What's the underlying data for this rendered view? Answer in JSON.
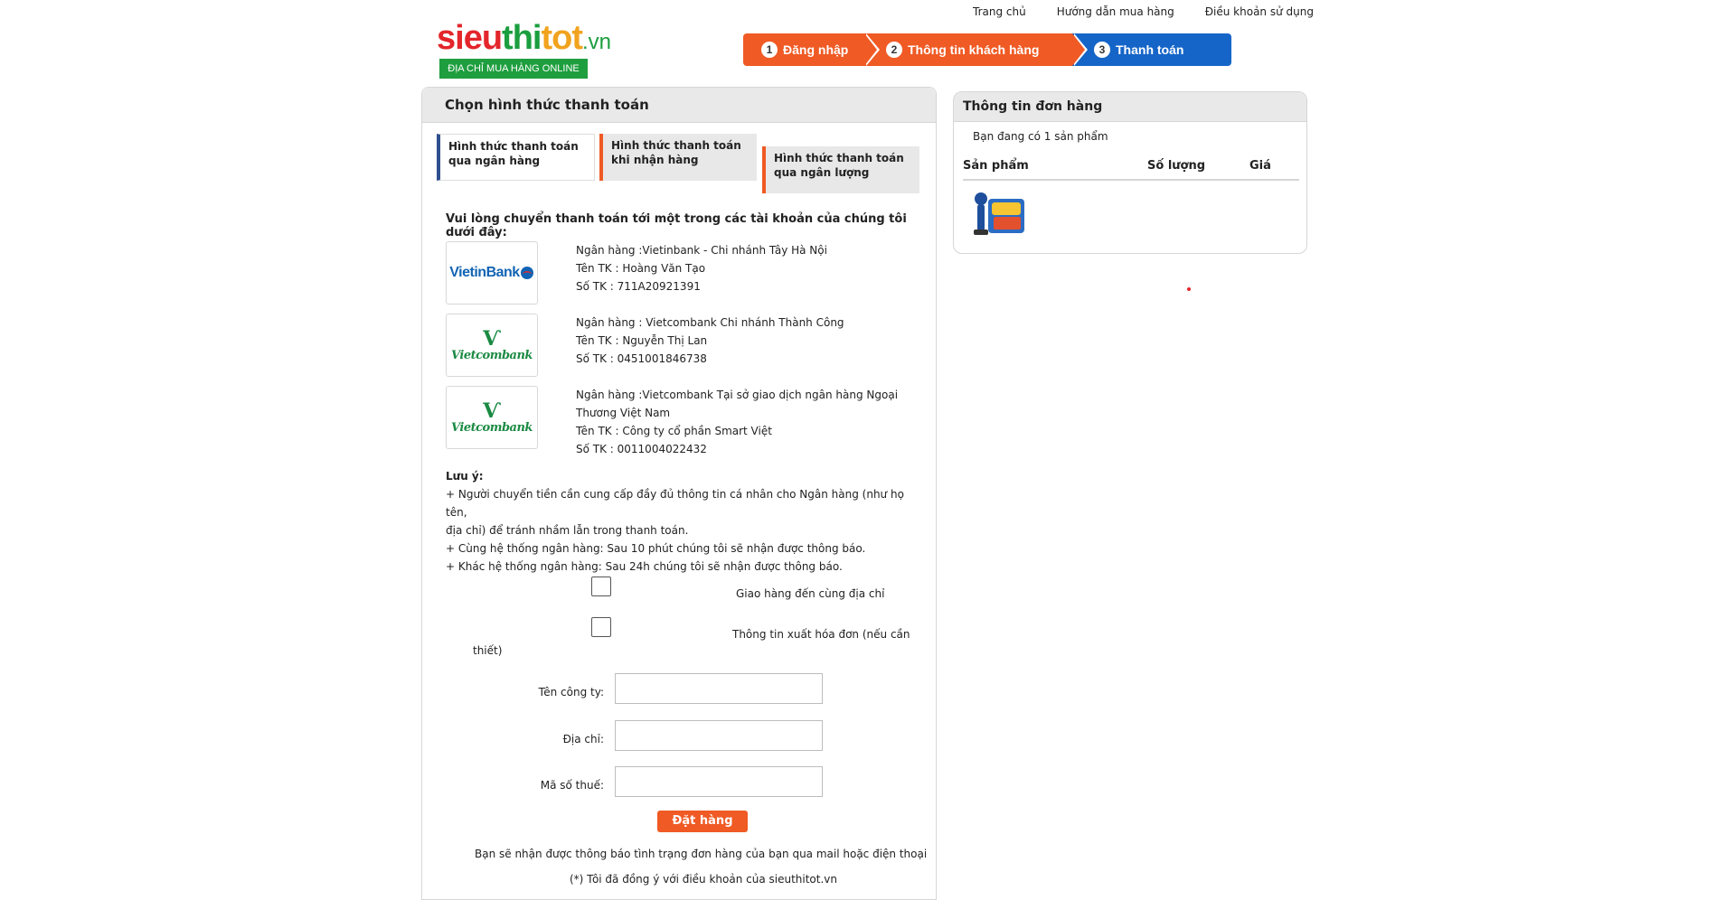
{
  "toplinks": {
    "home": "Trang chủ",
    "guide": "Hướng dẫn mua hàng",
    "terms": "Điều khoản sử dụng"
  },
  "logo": {
    "part1": "sieu",
    "part2": "thi",
    "part3": "tot",
    "domain": ".vn",
    "tagline": "ĐỊA CHỈ MUA HÀNG ONLINE"
  },
  "steps": [
    {
      "num": "1",
      "label": "Đăng nhập"
    },
    {
      "num": "2",
      "label": "Thông tin khách hàng"
    },
    {
      "num": "3",
      "label": "Thanh toán"
    }
  ],
  "payment": {
    "title": "Chọn hình thức thanh toán",
    "tabs": [
      "Hình thức thanh toán qua ngân hàng",
      "Hình thức thanh toán khi nhận hàng",
      "Hình thức thanh toán qua ngân lượng"
    ],
    "instruction": "Vui lòng chuyển thanh toán tới một trong các tài khoản của chúng tôi dưới đây:",
    "banks": [
      {
        "logo": "VietinBank",
        "line1": "Ngân hàng :Vietinbank - Chi nhánh Tây Hà Nội",
        "line2": "Tên TK : Hoàng Văn Tạo",
        "line3": "Số TK : 711A20921391"
      },
      {
        "logo": "Vietcombank",
        "line1": "Ngân hàng : Vietcombank Chi nhánh Thành Công",
        "line2": "Tên TK : Nguyễn Thị Lan",
        "line3": "Số TK : 0451001846738"
      },
      {
        "logo": "Vietcombank",
        "line1": "Ngân hàng :Vietcombank Tại sở giao dịch ngân hàng Ngoại",
        "line1b": "Thương Việt Nam",
        "line2": "Tên TK : Công ty cổ phần Smart Việt",
        "line3": "Số TK : 0011004022432"
      }
    ],
    "note": {
      "title": "Lưu ý:",
      "l1": "+ Người chuyển tiền cần cung cấp đầy đủ thông tin cá nhân cho Ngân hàng (như họ tên,",
      "l2": "địa chỉ) để tránh nhầm lẫn trong thanh toán.",
      "l3": "+ Cùng hệ thống ngân hàng: Sau 10 phút chúng tôi sẽ nhận được thông báo.",
      "l4": "+ Khác hệ thống ngân hàng: Sau 24h chúng tôi sẽ nhận được thông báo."
    },
    "check_same_address": "Giao hàng đến cùng địa chỉ",
    "check_invoice_a": "Thông tin xuất hóa đơn (nếu cần",
    "check_invoice_b": "thiết)",
    "company_label": "Tên công ty:",
    "address_label": "Địa chỉ:",
    "tax_label": "Mã số thuế:",
    "order_button": "Đặt hàng",
    "footer1": "Bạn sẽ nhận được thông báo tình trạng đơn hàng của bạn qua mail hoặc điện thoại",
    "footer2": "(*) Tôi đã đồng ý với điều khoản của sieuthitot.vn"
  },
  "order": {
    "title": "Thông tin đơn hàng",
    "count": "Bạn đang có 1 sản phẩm",
    "col_product": "Sản phẩm",
    "col_qty": "Số lượng",
    "col_price": "Giá"
  },
  "colors": {
    "orange": "#f05a24",
    "blue": "#1565c8",
    "green": "#1e9e3e"
  }
}
